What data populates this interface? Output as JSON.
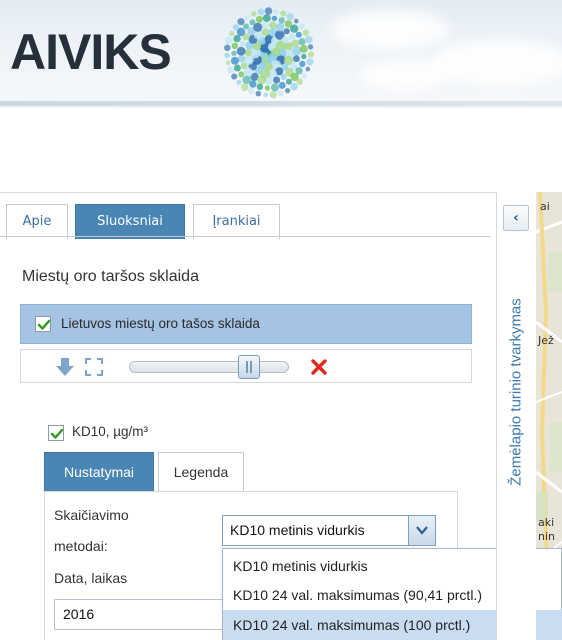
{
  "header": {
    "logo_text": "AIVIKS",
    "brand_colors": {
      "dark": "#25303b",
      "teal": "#1f9a8c",
      "blue": "#2f6fb0",
      "green": "#6cc04a"
    }
  },
  "panel": {
    "tabs": [
      {
        "label": "Apie",
        "active": false
      },
      {
        "label": "Sluoksniai",
        "active": true
      },
      {
        "label": "Įrankiai",
        "active": false
      }
    ],
    "section_title": "Miestų oro taršos sklaida",
    "layer": {
      "label": "Lietuvos miestų oro tašos sklaida",
      "checked": true,
      "opacity": 0.75
    },
    "controls": {
      "icons": [
        "download-arrow-icon",
        "fullscreen-icon",
        "opacity-slider",
        "remove-icon"
      ]
    },
    "sublayer": {
      "label": "KD10, µg/m³",
      "checked": true,
      "tabs": [
        {
          "label": "Nustatymai",
          "active": true
        },
        {
          "label": "Legenda",
          "active": false
        }
      ],
      "method_label_line1": "Skaičiavimo",
      "method_label_line2": "metodai:",
      "method_selected": "KD10 metinis vidurkis",
      "date_label": "Data, laikas",
      "date_value": "2016",
      "dropdown_options": [
        "KD10 metinis vidurkis",
        "KD10 24 val. maksimumas (90,41 prctl.)",
        "KD10 24 val. maksimumas (100 prctl.)"
      ],
      "dropdown_highlighted_index": 2
    }
  },
  "side_tab": {
    "collapse_label": "‹",
    "title": "Žemėlapio turinio tvarkymas"
  },
  "map": {
    "visible_labels": [
      "ai",
      "Jež",
      "aki",
      "nin"
    ]
  }
}
